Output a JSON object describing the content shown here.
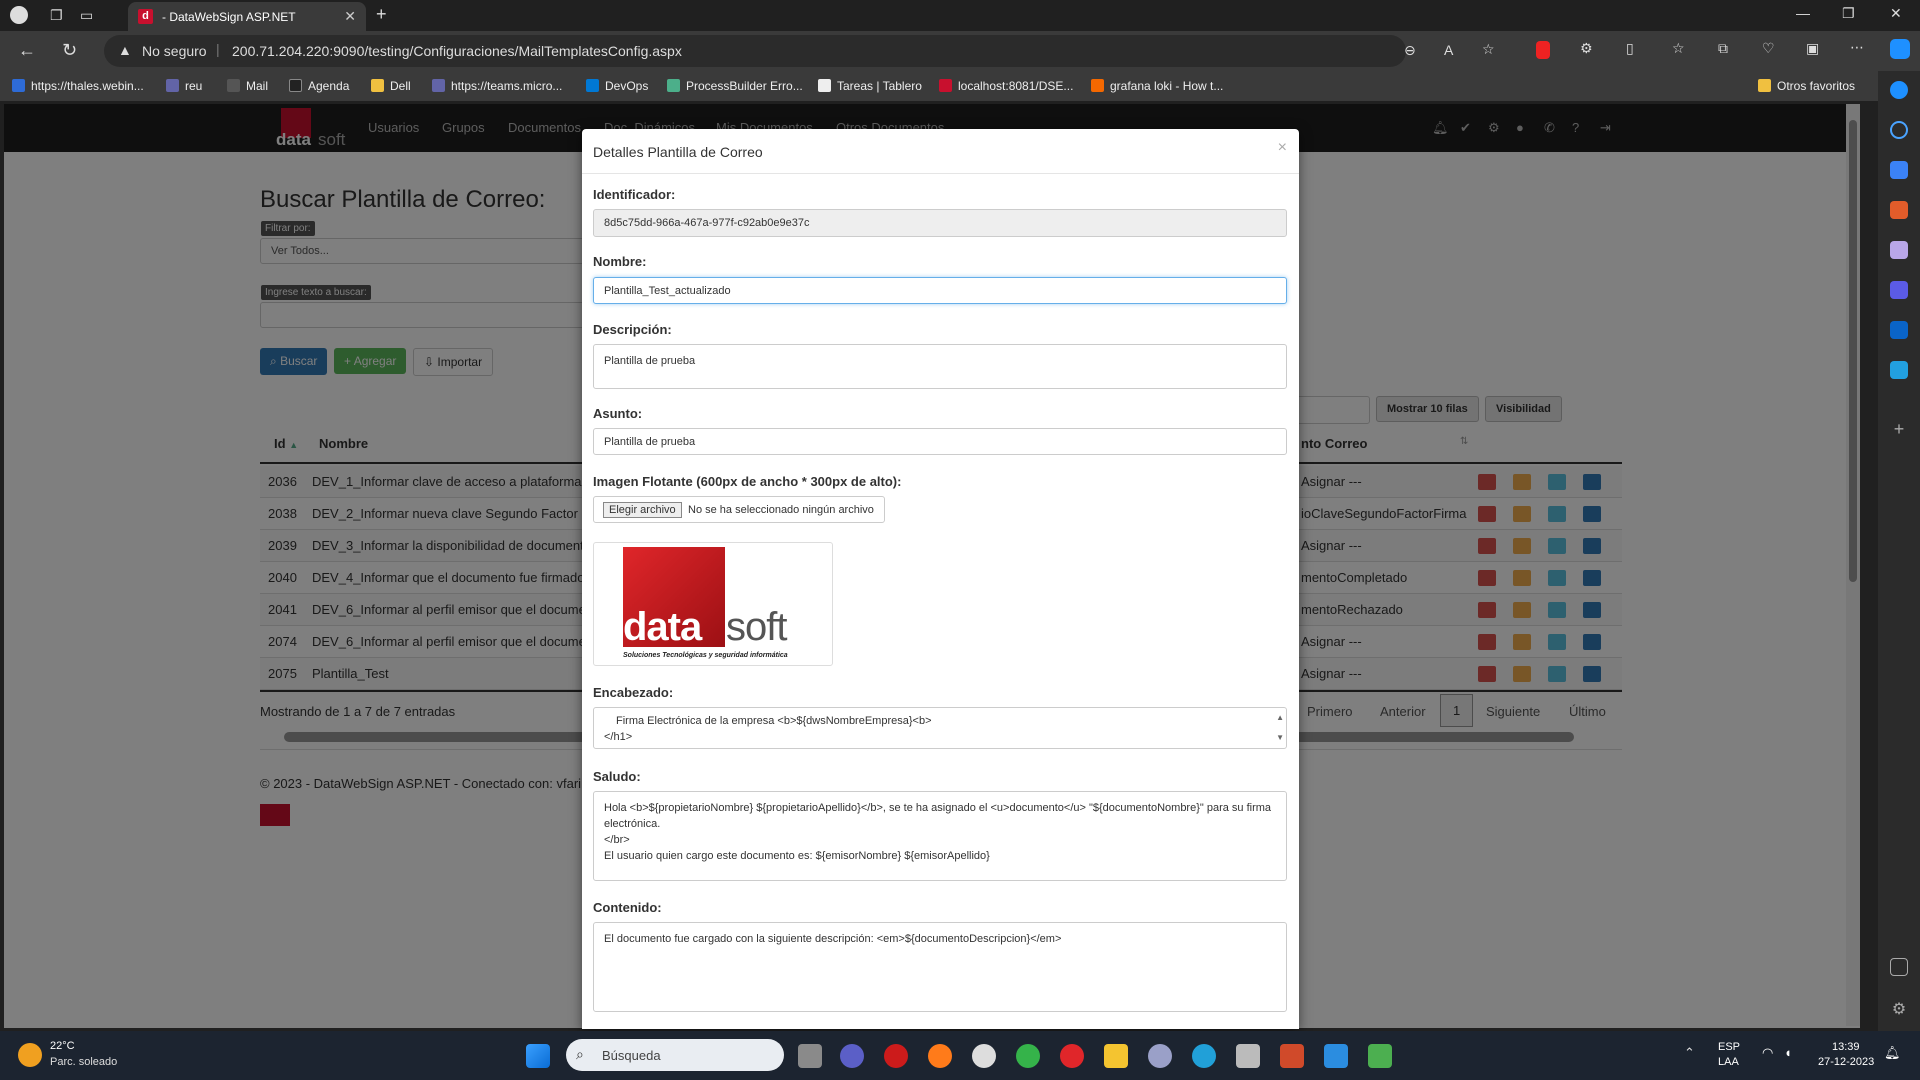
{
  "browser": {
    "tab_title": "- DataWebSign ASP.NET",
    "security_label": "No seguro",
    "url": "200.71.204.220:9090/testing/Configuraciones/MailTemplatesConfig.aspx",
    "bookmarks": [
      {
        "label": "https://thales.webin...",
        "color": "#2e6bd6"
      },
      {
        "label": "reu",
        "color": "#6264a7"
      },
      {
        "label": "Mail",
        "color": "#555"
      },
      {
        "label": "Agenda",
        "color": "#222"
      },
      {
        "label": "Dell",
        "color": "#f0c040"
      },
      {
        "label": "https://teams.micro...",
        "color": "#6264a7"
      },
      {
        "label": "DevOps",
        "color": "#0078d4"
      },
      {
        "label": "ProcessBuilder Erro...",
        "color": "#4caf8a"
      },
      {
        "label": "Tareas | Tablero",
        "color": "#eee"
      },
      {
        "label": "localhost:8081/DSE...",
        "color": "#c8102e"
      },
      {
        "label": "grafana loki - How t...",
        "color": "#f46800"
      }
    ],
    "other_favorites": "Otros favoritos"
  },
  "app": {
    "brand_left": "data",
    "brand_right": "soft",
    "nav": [
      "Usuarios",
      "Grupos",
      "Documentos",
      "Doc. Dinámicos",
      "Mis Documentos",
      "Otros Documentos"
    ],
    "page_title": "Buscar Plantilla de Correo:",
    "filter_tag": "Filtrar por:",
    "filter_value": "Ver Todos...",
    "search_tag": "Ingrese texto a buscar:",
    "btn_search": "Buscar",
    "btn_add": "Agregar",
    "btn_import": "Importar",
    "btn_show_rows": "Mostrar 10 filas",
    "btn_visibility": "Visibilidad",
    "col_id": "Id",
    "col_name": "Nombre",
    "col_event": "nto Correo",
    "rows": [
      {
        "id": "2036",
        "name": "DEV_1_Informar clave de acceso a plataforma",
        "event": "Asignar ---"
      },
      {
        "id": "2038",
        "name": "DEV_2_Informar nueva clave Segundo Factor",
        "event": "ioClaveSegundoFactorFirma"
      },
      {
        "id": "2039",
        "name": "DEV_3_Informar la disponibilidad de document",
        "event": "Asignar ---"
      },
      {
        "id": "2040",
        "name": "DEV_4_Informar que el documento fue firmado",
        "event": "mentoCompletado"
      },
      {
        "id": "2041",
        "name": "DEV_6_Informar al perfil emisor que el docume",
        "event": "mentoRechazado"
      },
      {
        "id": "2074",
        "name": "DEV_6_Informar al perfil emisor que el docume",
        "event": "Asignar ---"
      },
      {
        "id": "2075",
        "name": "Plantilla_Test",
        "event": "Asignar ---"
      }
    ],
    "showing": "Mostrando de 1 a 7 de 7 entradas",
    "pager": {
      "first": "Primero",
      "prev": "Anterior",
      "page": "1",
      "next": "Siguiente",
      "last": "Último"
    },
    "footer": "© 2023 - DataWebSign ASP.NET - Conectado con: vfari"
  },
  "modal": {
    "title": "Detalles Plantilla de Correo",
    "close": "×",
    "id_label": "Identificador:",
    "id_value": "8d5c75dd-966a-467a-977f-c92ab0e9e37c",
    "name_label": "Nombre:",
    "name_value": "Plantilla_Test_actualizado",
    "desc_label": "Descripción:",
    "desc_value": "Plantilla de prueba",
    "subject_label": "Asunto:",
    "subject_value": "Plantilla de prueba",
    "image_label": "Imagen Flotante (600px de ancho * 300px de alto):",
    "file_button": "Elegir archivo",
    "file_status": "No se ha seleccionado ningún archivo",
    "logo_left": "data",
    "logo_right": "soft",
    "logo_tagline": "Soluciones Tecnológicas y seguridad informática",
    "header_label": "Encabezado:",
    "header_line1": "Firma Electrónica de la empresa <b>${dwsNombreEmpresa}<b>",
    "header_line2": "</h1>",
    "greeting_label": "Saludo:",
    "greeting_text1": "Hola <b>${propietarioNombre} ${propietarioApellido}</b>, se te ha asignado el <u>documento</u> \"${documentoNombre}\" para su firma electrónica.",
    "greeting_text2": "</br>",
    "greeting_text3": "El usuario quien cargo este documento es: ${emisorNombre} ${emisorApellido}",
    "content_label": "Contenido:",
    "content_value": "El documento fue cargado con la siguiente descripción: <em>${documentoDescripcion}</em>"
  },
  "taskbar": {
    "temp": "22°C",
    "weather": "Parc. soleado",
    "search": "Búsqueda",
    "lang1": "ESP",
    "lang2": "LAA",
    "time": "13:39",
    "date": "27-12-2023"
  }
}
